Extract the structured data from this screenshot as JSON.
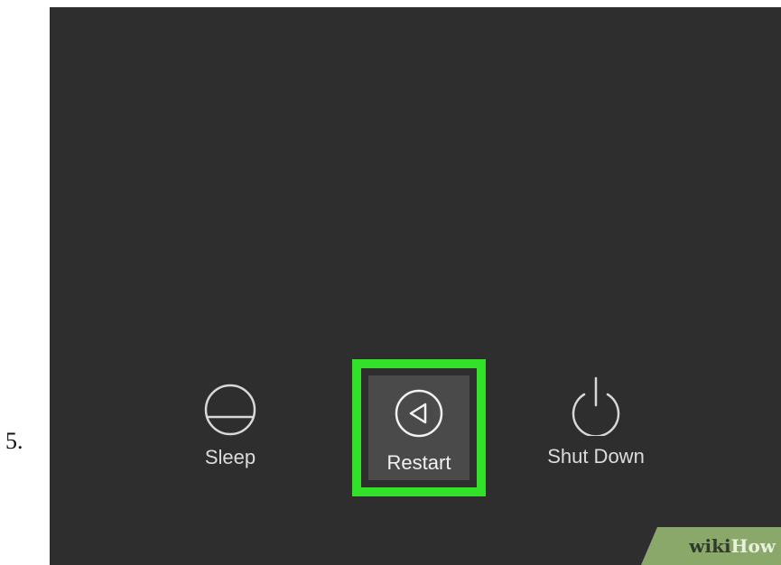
{
  "step": {
    "number": "5."
  },
  "power_menu": {
    "options": [
      {
        "id": "sleep",
        "label": "Sleep",
        "icon": "sleep-icon",
        "highlighted": false
      },
      {
        "id": "restart",
        "label": "Restart",
        "icon": "restart-icon",
        "highlighted": true
      },
      {
        "id": "shutdown",
        "label": "Shut Down",
        "icon": "power-icon",
        "highlighted": false
      }
    ],
    "highlight_color": "#33e02a",
    "background_color": "#2e2e2e"
  },
  "watermark": {
    "part1": "wiki",
    "part2": "How"
  }
}
